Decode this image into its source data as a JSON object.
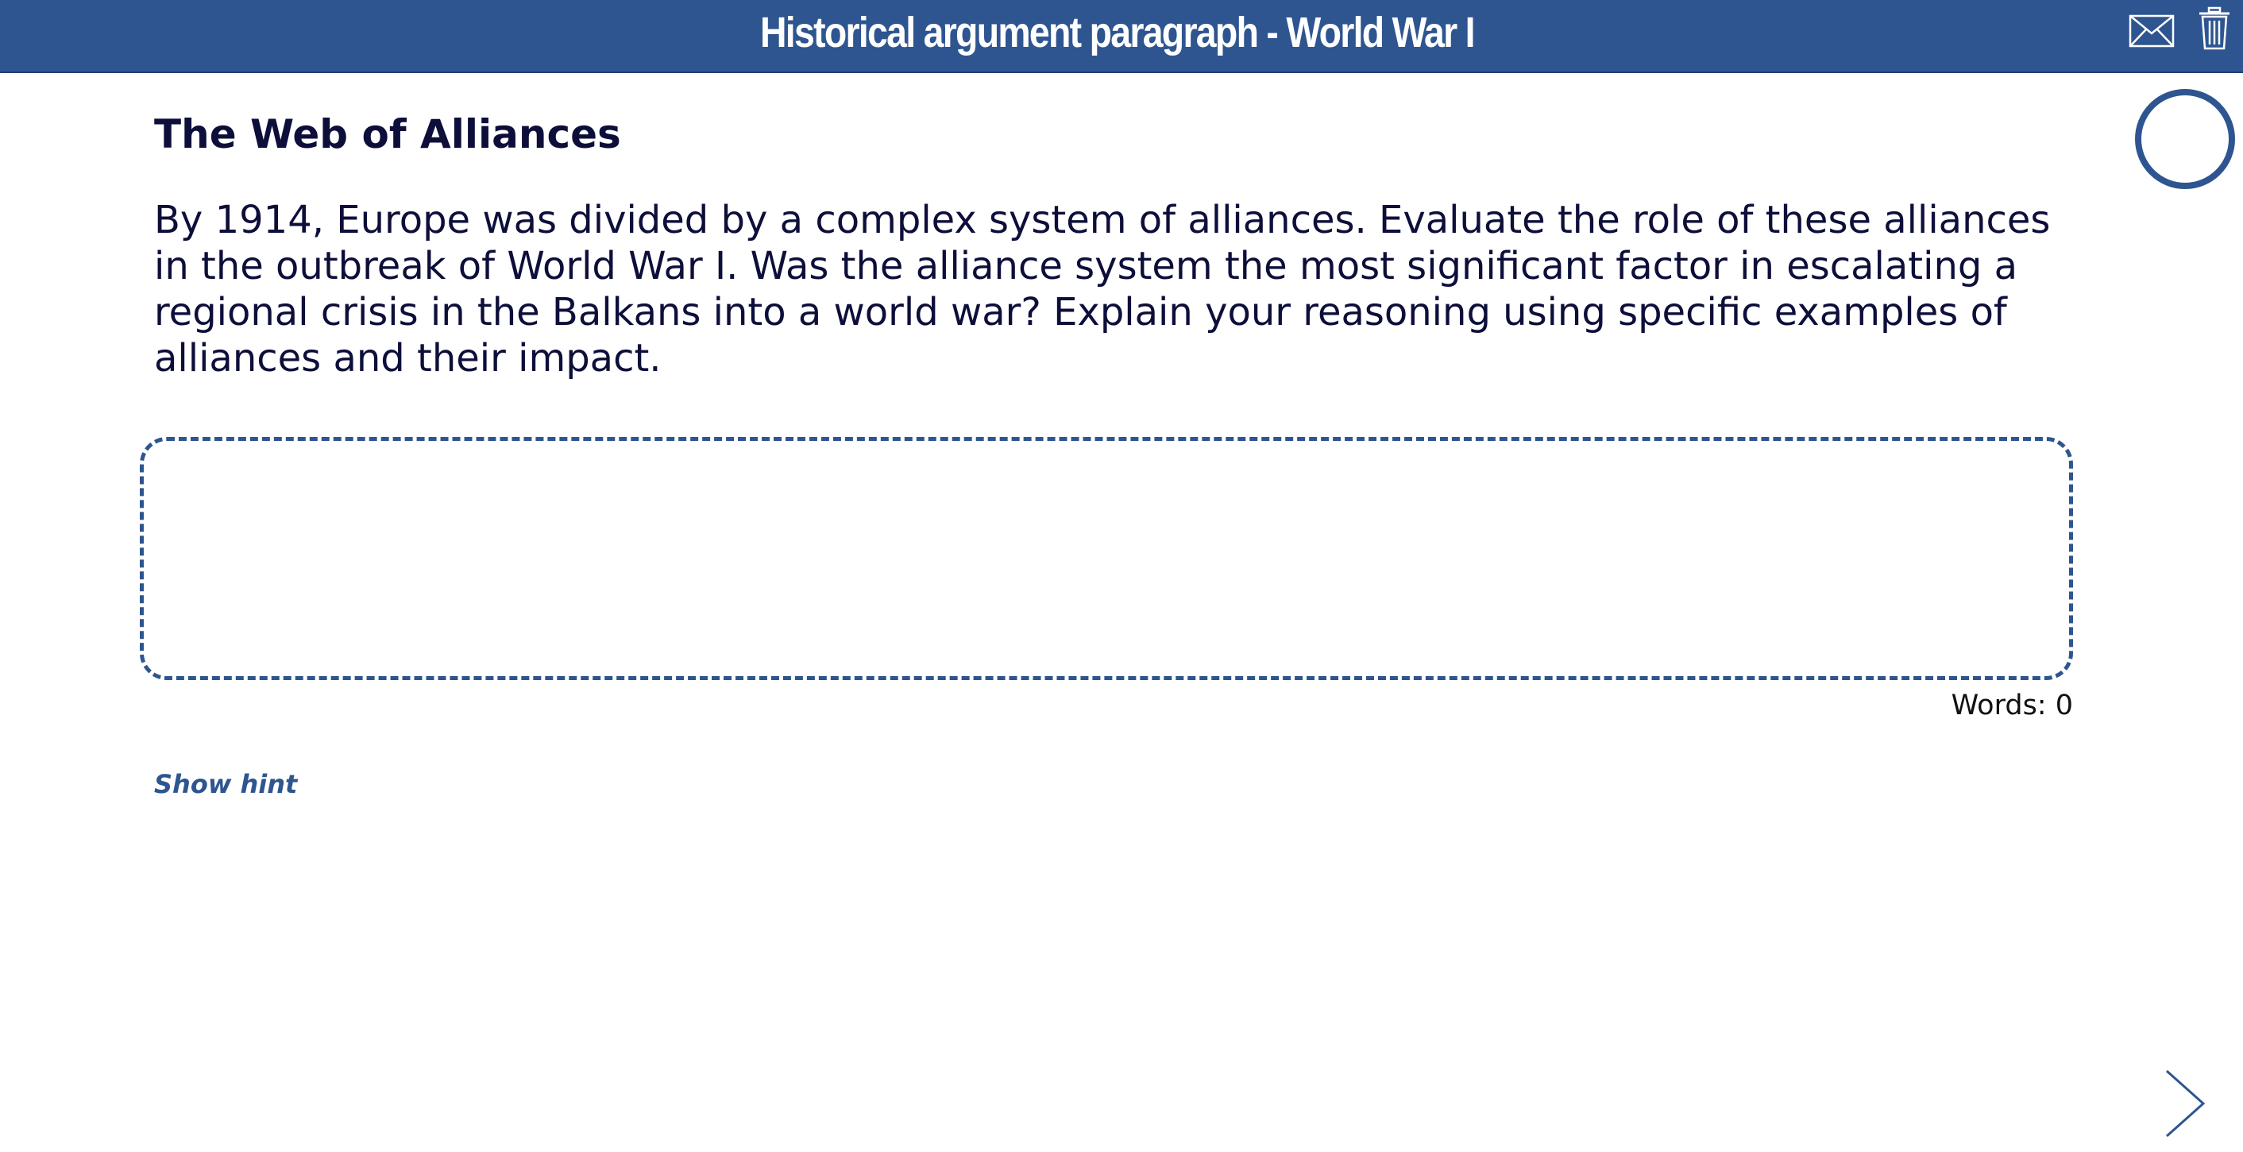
{
  "header": {
    "title": "Historical argument paragraph - World War I",
    "mail_icon": "mail-icon",
    "trash_icon": "trash-icon"
  },
  "progress": {
    "icon": "progress-ring",
    "value": 0
  },
  "content": {
    "section_title": "The Web of Alliances",
    "prompt": "By 1914, Europe was divided by a complex system of alliances. Evaluate the role of these alliances in the outbreak of World War I. Was the alliance system the most significant factor in escalating a regional crisis in the Balkans into a world war? Explain your reasoning using specific examples of alliances and their impact."
  },
  "answer": {
    "value": "",
    "word_count_label": "Words: 0"
  },
  "hint": {
    "label": "Show hint"
  },
  "navigation": {
    "next_icon": "chevron-right-icon"
  },
  "colors": {
    "primary": "#2e5590",
    "text": "#0d0f3a",
    "background": "#ffffff"
  }
}
